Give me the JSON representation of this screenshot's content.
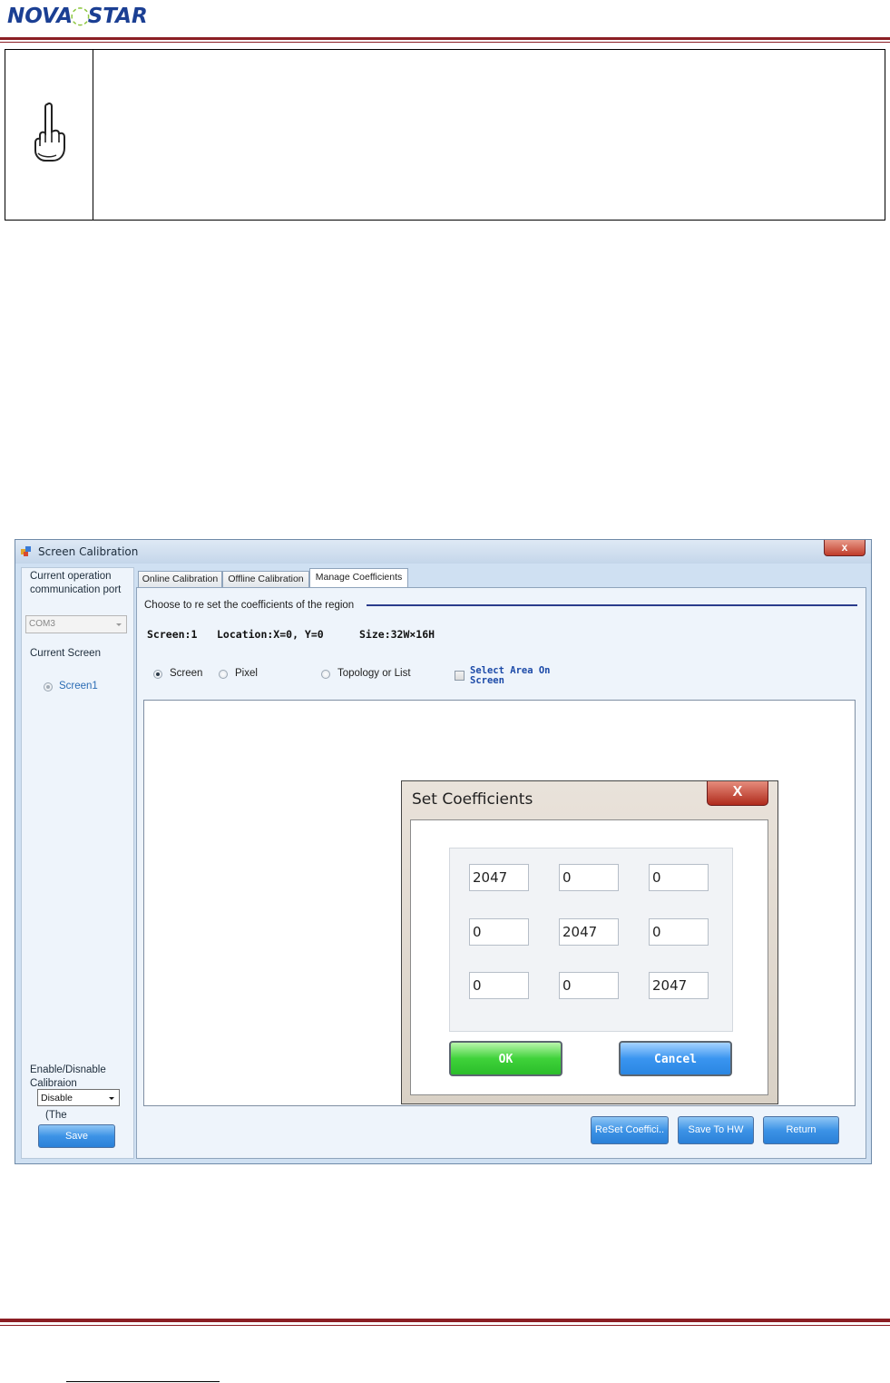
{
  "logo": {
    "part1": "NOVA",
    "part2": "STAR"
  },
  "window": {
    "title": "Screen Calibration",
    "close": "x",
    "left_panel": {
      "comm_port_label": "Current operation communication port",
      "comm_port_value": "COM3",
      "current_screen_label": "Current Screen",
      "screen_item": "Screen1",
      "enable_label": "Enable/Disnable Calibraion",
      "enable_value": "Disable",
      "truncated_text": "(The",
      "save_button": "Save"
    },
    "tabs": [
      "Online Calibration",
      "Offline Calibration",
      "Manage Coefficients"
    ],
    "main": {
      "group_title": "Choose to re set the coefficients of the region",
      "screen_info": "Screen:1",
      "location_info": "Location:X=0, Y=0",
      "size_info": "Size:32W×16H",
      "options": [
        "Screen",
        "Pixel",
        "Topology or List"
      ],
      "select_area_line1": "Select Area On",
      "select_area_line2": "Screen",
      "buttons": [
        "ReSet Coeffici..",
        "Save To HW",
        "Return"
      ]
    },
    "dialog": {
      "title": "Set Coefficients",
      "close": "X",
      "matrix": [
        [
          "2047",
          "0",
          "0"
        ],
        [
          "0",
          "2047",
          "0"
        ],
        [
          "0",
          "0",
          "2047"
        ]
      ],
      "ok": "OK",
      "cancel": "Cancel"
    }
  },
  "colors": {
    "brand_blue": "#1b3f93",
    "brand_green": "#8cc63e",
    "rule_red": "#8b1e24",
    "ok_green": "#3fd23a",
    "button_blue": "#3a95f0"
  }
}
